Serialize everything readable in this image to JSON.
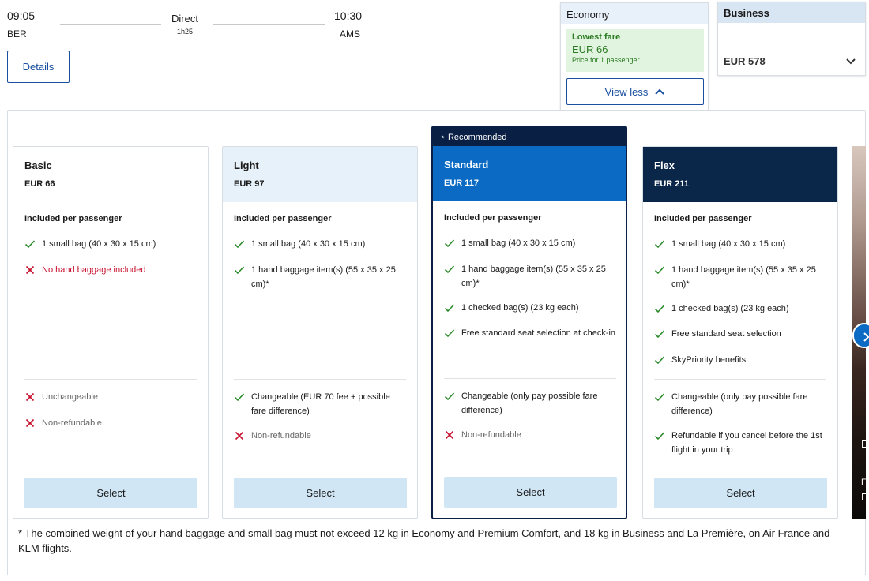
{
  "flight": {
    "departure_time": "09:05",
    "departure_code": "BER",
    "stops": "Direct",
    "duration": "1h25",
    "arrival_time": "10:30",
    "arrival_code": "AMS",
    "details_label": "Details"
  },
  "cabins": {
    "economy": {
      "title": "Economy",
      "lowest_label": "Lowest fare",
      "lowest_price": "EUR 66",
      "price_note": "Price for 1 passenger",
      "view_less_label": "View less"
    },
    "business": {
      "title": "Business",
      "price": "EUR 578"
    }
  },
  "fares": {
    "basic": {
      "name": "Basic",
      "price": "EUR 66",
      "included_heading": "Included per passenger",
      "features": [
        "1 small bag (40 x 30 x 15 cm)",
        "No hand baggage included"
      ],
      "conditions": [
        "Unchangeable",
        "Non-refundable"
      ],
      "select_label": "Select"
    },
    "light": {
      "name": "Light",
      "price": "EUR 97",
      "included_heading": "Included per passenger",
      "features": [
        "1 small bag (40 x 30 x 15 cm)",
        "1 hand baggage item(s) (55 x 35 x 25 cm)*"
      ],
      "conditions": [
        "Changeable (EUR 70 fee + possible fare difference)",
        "Non-refundable"
      ],
      "select_label": "Select"
    },
    "standard": {
      "badge": "Recommended",
      "name": "Standard",
      "price": "EUR 117",
      "included_heading": "Included per passenger",
      "features": [
        "1 small bag (40 x 30 x 15 cm)",
        "1 hand baggage item(s) (55 x 35 x 25 cm)*",
        "1 checked bag(s) (23 kg each)",
        "Free standard seat selection at check-in"
      ],
      "conditions": [
        "Changeable (only pay possible fare difference)",
        "Non-refundable"
      ],
      "select_label": "Select"
    },
    "flex": {
      "name": "Flex",
      "price": "EUR 211",
      "included_heading": "Included per passenger",
      "features": [
        "1 small bag (40 x 30 x 15 cm)",
        "1 hand baggage item(s) (55 x 35 x 25 cm)*",
        "1 checked bag(s) (23 kg each)",
        "Free standard seat selection",
        "SkyPriority benefits"
      ],
      "conditions": [
        "Changeable (only pay possible fare difference)",
        "Refundable if you cancel before the 1st flight in your trip"
      ],
      "select_label": "Select"
    }
  },
  "promo": {
    "line1": "E",
    "line2": "F",
    "line3": "E"
  },
  "footnote": "* The combined weight of your hand baggage and small bag must not exceed 12 kg in Economy and Premium Comfort, and 18 kg in Business and La Première, on Air France and KLM flights.",
  "colors": {
    "primary": "#1a4fa0",
    "standard_header": "#0b6bc4",
    "navy": "#0a1f44",
    "check_green": "#2a8a2a",
    "cross_red": "#c8102e",
    "select_bg": "#d0e6f5"
  }
}
